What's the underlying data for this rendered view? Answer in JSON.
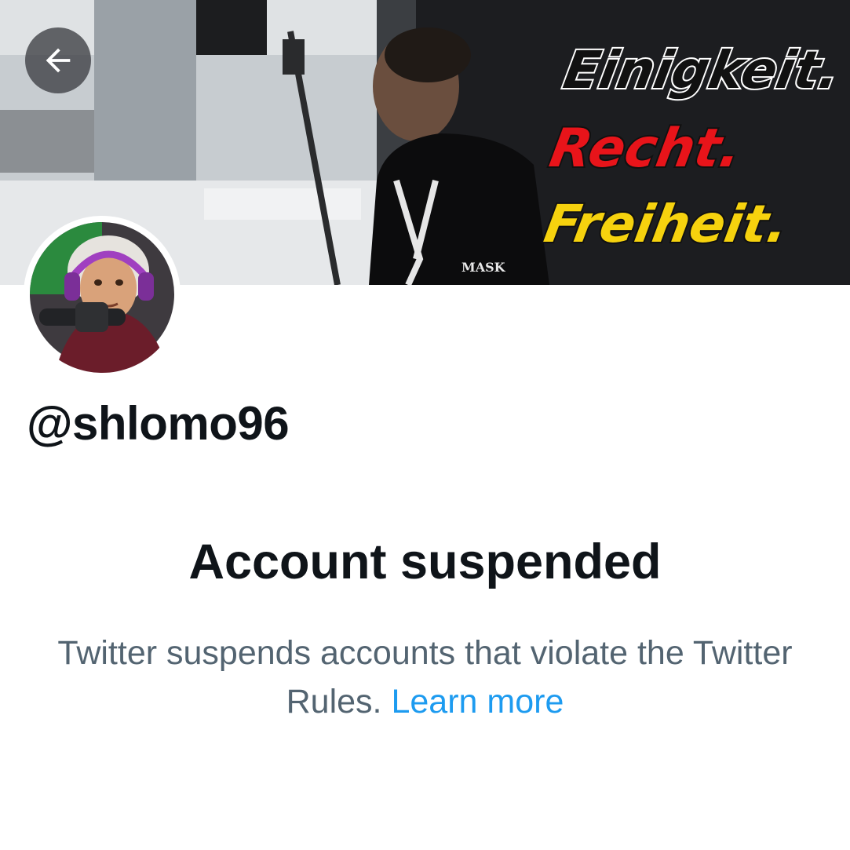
{
  "banner": {
    "lines": [
      "Einigkeit.",
      "Recht.",
      "Freiheit."
    ],
    "line_colors": [
      "#111111",
      "#e8141a",
      "#f6d20e"
    ],
    "shirt_text": "MASK"
  },
  "nav": {
    "back_icon": "arrow-left-icon"
  },
  "profile": {
    "handle": "@shlomo96"
  },
  "status": {
    "title": "Account suspended",
    "body": "Twitter suspends accounts that violate the Twitter Rules.",
    "link_label": "Learn more",
    "link_color": "#1d9bf0"
  }
}
